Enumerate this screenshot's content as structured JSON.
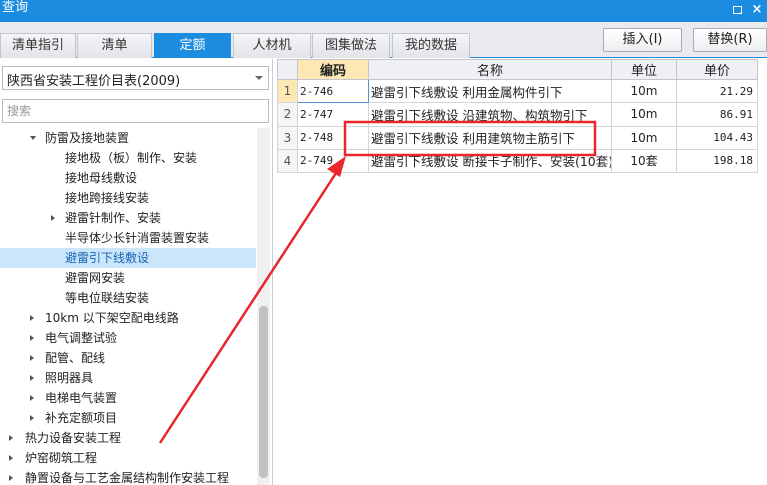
{
  "window": {
    "title": "查询",
    "close_glyph": "×"
  },
  "tabs": [
    {
      "label": "清单指引",
      "active": false
    },
    {
      "label": "清单",
      "active": false
    },
    {
      "label": "定额",
      "active": true
    },
    {
      "label": "人材机",
      "active": false
    },
    {
      "label": "图集做法",
      "active": false
    },
    {
      "label": "我的数据",
      "active": false
    }
  ],
  "actions": {
    "insert_label": "插入(I)",
    "replace_label": "替换(R)"
  },
  "sidebar": {
    "catalog_selected": "陕西省安装工程价目表(2009)",
    "search_placeholder": "搜索",
    "tree": [
      {
        "label": "防雷及接地装置",
        "expander": "down"
      },
      {
        "label": "接地极（板）制作、安装",
        "expander": "none"
      },
      {
        "label": "接地母线敷设",
        "expander": "none"
      },
      {
        "label": "接地跨接线安装",
        "expander": "none"
      },
      {
        "label": "避雷针制作、安装",
        "expander": "right"
      },
      {
        "label": "半导体少长针消雷装置安装",
        "expander": "none"
      },
      {
        "label": "避雷引下线敷设",
        "expander": "none",
        "selected": true
      },
      {
        "label": "避雷网安装",
        "expander": "none"
      },
      {
        "label": "等电位联结安装",
        "expander": "none"
      },
      {
        "label": "10km 以下架空配电线路",
        "expander": "right"
      },
      {
        "label": "电气调整试验",
        "expander": "right"
      },
      {
        "label": "配管、配线",
        "expander": "right"
      },
      {
        "label": "照明器具",
        "expander": "right"
      },
      {
        "label": "电梯电气装置",
        "expander": "right"
      },
      {
        "label": "补充定额项目",
        "expander": "right"
      },
      {
        "label": "热力设备安装工程",
        "expander": "right"
      },
      {
        "label": "炉窑砌筑工程",
        "expander": "right"
      },
      {
        "label": "静置设备与工艺金属结构制作安装工程",
        "expander": "right"
      }
    ]
  },
  "table": {
    "headers": {
      "code": "编码",
      "name": "名称",
      "unit": "单位",
      "price": "单价"
    },
    "rows": [
      {
        "no": "1",
        "code": "2-746",
        "name": "避雷引下线敷设 利用金属构件引下",
        "unit": "10m",
        "price": "21.29"
      },
      {
        "no": "2",
        "code": "2-747",
        "name": "避雷引下线敷设 沿建筑物、构筑物引下",
        "unit": "10m",
        "price": "86.91"
      },
      {
        "no": "3",
        "code": "2-748",
        "name": "避雷引下线敷设 利用建筑物主筋引下",
        "unit": "10m",
        "price": "104.43"
      },
      {
        "no": "4",
        "code": "2-749",
        "name": "避雷引下线敷设 断接卡子制作、安装(10套)",
        "unit": "10套",
        "price": "198.18"
      }
    ]
  },
  "colors": {
    "accent": "#1b8ce0",
    "annotation": "#e8262b",
    "selected_row": "#cbe6fb",
    "header_highlight": "#fde8b4"
  }
}
